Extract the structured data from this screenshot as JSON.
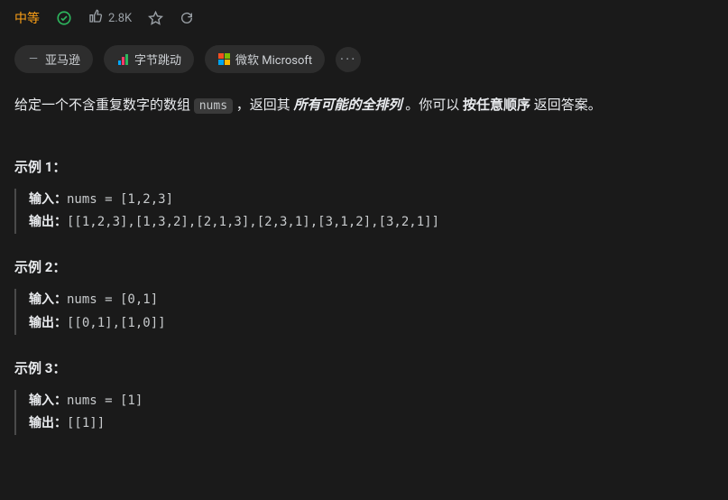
{
  "header": {
    "difficulty": "中等",
    "likes": "2.8K"
  },
  "companies": {
    "amazon": "亚马逊",
    "bytedance": "字节跳动",
    "microsoft": "微软 Microsoft"
  },
  "description": {
    "pre": "给定一个不含重复数字的数组 ",
    "code": "nums",
    "mid1": " ，返回其 ",
    "italic": "所有可能的全排列",
    "mid2": " 。你可以 ",
    "bold": "按任意顺序",
    "post": " 返回答案。"
  },
  "examples": [
    {
      "title": "示例 1：",
      "input_label": "输入：",
      "input_value": "nums = [1,2,3]",
      "output_label": "输出：",
      "output_value": "[[1,2,3],[1,3,2],[2,1,3],[2,3,1],[3,1,2],[3,2,1]]"
    },
    {
      "title": "示例 2：",
      "input_label": "输入：",
      "input_value": "nums = [0,1]",
      "output_label": "输出：",
      "output_value": "[[0,1],[1,0]]"
    },
    {
      "title": "示例 3：",
      "input_label": "输入：",
      "input_value": "nums = [1]",
      "output_label": "输出：",
      "output_value": "[[1]]"
    }
  ]
}
